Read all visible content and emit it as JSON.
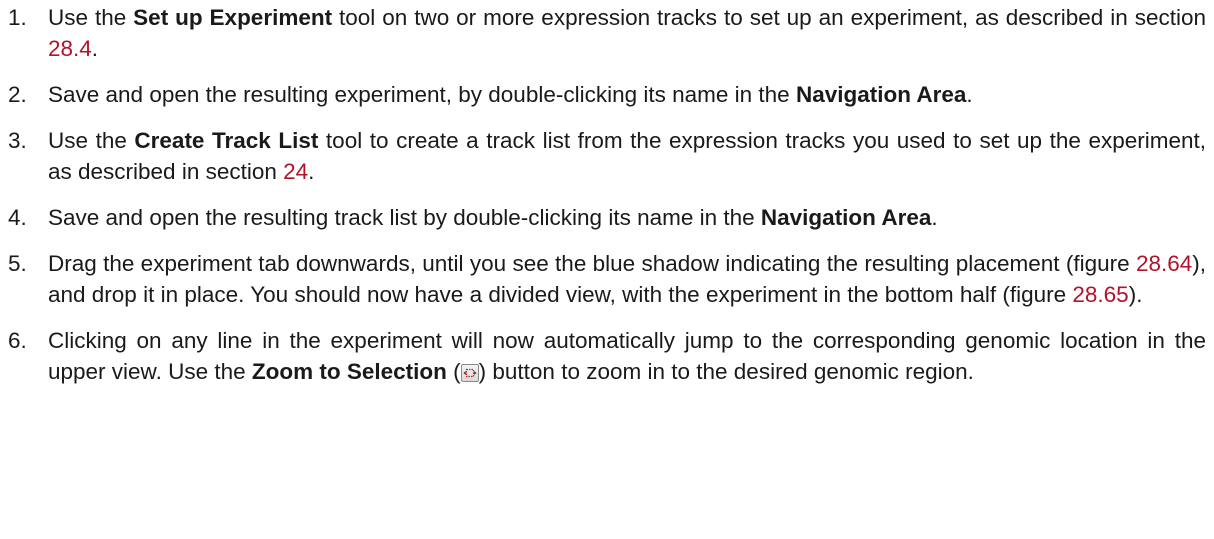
{
  "steps": [
    {
      "num": "1.",
      "t1": "Use the ",
      "b1": "Set up Experiment",
      "t2": " tool on two or more expression tracks to set up an experiment, as described in section ",
      "r1": "28.4",
      "t3": "."
    },
    {
      "num": "2.",
      "t1": "Save and open the resulting experiment, by double-clicking its name in the ",
      "b1": "Navigation Area",
      "t2": "."
    },
    {
      "num": "3.",
      "t1": "Use the ",
      "b1": "Create Track List",
      "t2": " tool to create a track list from the expression tracks you used to set up the experiment, as described in section ",
      "r1": "24",
      "t3": "."
    },
    {
      "num": "4.",
      "t1": "Save and open the resulting track list by double-clicking its name in the ",
      "b1": "Navigation Area",
      "t2": "."
    },
    {
      "num": "5.",
      "t1": "Drag the experiment tab downwards, until you see the blue shadow indicating the resulting placement (figure ",
      "r1": "28.64",
      "t2": "), and drop it in place. You should now have a divided view, with the experiment in the bottom half (figure ",
      "r2": "28.65",
      "t3": ")."
    },
    {
      "num": "6.",
      "t1": "Clicking on any line in the experiment will now automatically jump to the corresponding genomic location in the upper view. Use the ",
      "b1": "Zoom to Selection",
      "t2": " (",
      "icon": "zoom-to-selection-icon",
      "t3": ") button to zoom in to the desired genomic region."
    }
  ],
  "colors": {
    "reference_link": "#b3122a",
    "text": "#1a1a1a",
    "icon_marker": "#d62020"
  }
}
